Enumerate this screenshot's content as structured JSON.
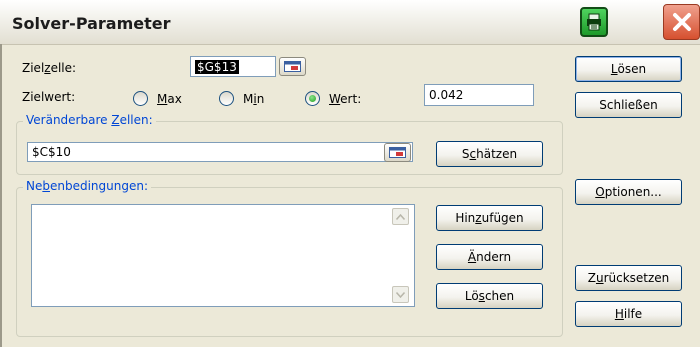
{
  "window": {
    "title": "Solver-Parameter",
    "close_label": "×"
  },
  "target": {
    "label_pre": "Ziel",
    "label_key": "z",
    "label_post": "elle:",
    "value": "$G$13"
  },
  "objective": {
    "label": "Zielwert:",
    "options": [
      {
        "pre": "",
        "key": "M",
        "post": "ax",
        "selected": false
      },
      {
        "pre": "M",
        "key": "i",
        "post": "n",
        "selected": false
      },
      {
        "pre": "",
        "key": "W",
        "post": "ert:",
        "selected": true
      }
    ],
    "value_of": "0.042"
  },
  "changing_cells": {
    "legend_pre": "Veränderbare ",
    "legend_key": "Z",
    "legend_post": "ellen:",
    "value": "$C$10",
    "guess_pre": "S",
    "guess_key": "c",
    "guess_post": "hätzen"
  },
  "constraints": {
    "legend_pre": "Ne",
    "legend_key": "b",
    "legend_post": "enbedingungen:",
    "items": [],
    "add_pre": "Hin",
    "add_key": "z",
    "add_post": "ufügen",
    "change_pre": "",
    "change_key": "Ä",
    "change_post": "ndern",
    "delete_pre": "Lö",
    "delete_key": "s",
    "delete_post": "chen"
  },
  "side_buttons": {
    "solve_pre": "",
    "solve_key": "L",
    "solve_post": "ösen",
    "close": "Schließen",
    "options_pre": "",
    "options_key": "O",
    "options_post": "ptionen...",
    "reset_pre": "Z",
    "reset_key": "u",
    "reset_post": "rücksetzen",
    "help_pre": "",
    "help_key": "H",
    "help_post": "ilfe"
  },
  "icons": {
    "titlebar_green": "printer-icon",
    "close": "close-icon",
    "ref_picker": "range-picker-icon",
    "scroll_up": "arrow-up-icon",
    "scroll_down": "arrow-down-icon"
  },
  "colors": {
    "dialog_bg": "#ECE9D8",
    "legend_text": "#0046D5",
    "close_red": "#D6502F",
    "green_button": "#1E9A2A"
  }
}
